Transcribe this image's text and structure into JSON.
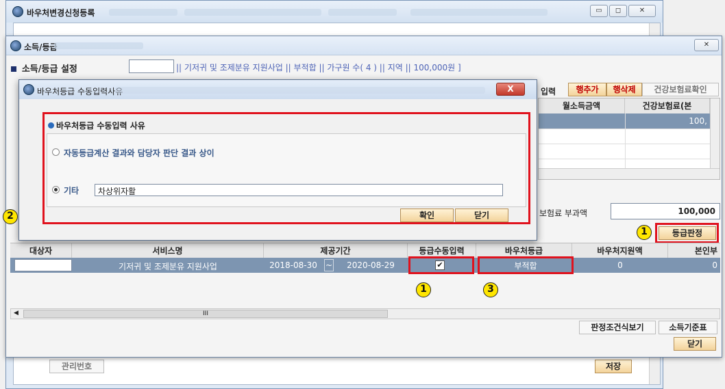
{
  "outer_window": {
    "title": "바우처변경신청등록",
    "bottom_left_label": "관리번호",
    "bottom_right_label": "저장"
  },
  "main_dialog": {
    "title": "소득/등급",
    "section_title": "소득/등급 설정",
    "info_line": "|| 기저귀 및 조제분유 지원사업 || 부적합 || 가구원 수( 4 ) || 지역 || 100,000원 ]",
    "toolbar": {
      "partial_label": "입력",
      "add_row": "행추가",
      "delete_row": "행삭제",
      "health_check": "건강보험료확인"
    },
    "income_grid": {
      "columns": [
        "월소득금액",
        "건강보험료(본"
      ],
      "rows": [
        {
          "income": "",
          "premium": "100,"
        }
      ]
    },
    "premium_label": "보험료 부과액",
    "premium_value": "100,000",
    "grade_button": "등급판정",
    "service_grid": {
      "columns": [
        "대상자",
        "서비스명",
        "제공기간",
        "등급수동입력",
        "바우처등급",
        "바우처지원액",
        "본인부"
      ],
      "rows": [
        {
          "subject": "",
          "service": "기저귀 및 조제분유 지원사업",
          "start": "2018-08-30",
          "sep": "~",
          "end": "2020-08-29",
          "manual": true,
          "grade": "부적합",
          "support": "0",
          "self": "0"
        }
      ]
    },
    "buttons": {
      "criteria_view": "판정조건식보기",
      "income_table": "소득기준표",
      "close": "닫기"
    },
    "scroll_mid": "III"
  },
  "sub_dialog": {
    "title": "바우처등급 수동입력사유",
    "close_x": "X",
    "heading": "바우처등급 수동입력 사유",
    "option1": "자동등급계산 결과와 담당자 판단 결과 상이",
    "option2": "기타",
    "input_value": "차상위자활",
    "selected": "option2",
    "confirm": "확인",
    "close": "닫기"
  },
  "annotations": {
    "circle1": "1",
    "circle2": "2",
    "circle3": "3"
  },
  "colors": {
    "highlight_red": "#e0121d",
    "marker_yellow": "#ffe600",
    "selection_row": "#7d95b1",
    "info_text": "#4d63b6"
  }
}
